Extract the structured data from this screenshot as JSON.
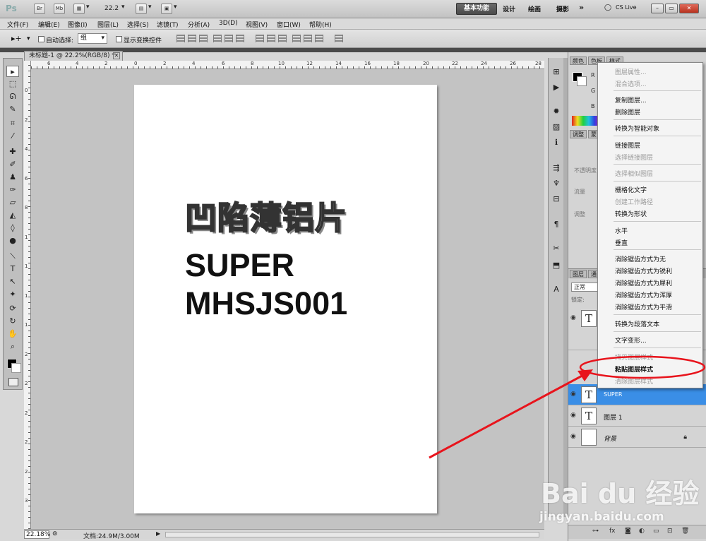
{
  "appbar": {
    "logo": "Ps",
    "btn_bridge": "Br",
    "btn_minibridge": "Mb",
    "zoom": "22.2",
    "workspaces": [
      "基本功能",
      "设计",
      "绘画",
      "摄影"
    ],
    "more": "»",
    "cs_live": "CS Live"
  },
  "menubar": [
    "文件(F)",
    "编辑(E)",
    "图像(I)",
    "图层(L)",
    "选择(S)",
    "滤镜(T)",
    "分析(A)",
    "3D(D)",
    "视图(V)",
    "窗口(W)",
    "帮助(H)"
  ],
  "options": {
    "auto_select_label": "自动选择:",
    "auto_select_value": "组",
    "show_transform_label": "显示变换控件"
  },
  "document": {
    "tab_title": "未标题-1 @ 22.2%(RGB/8) *",
    "ruler_h": [
      "6",
      "4",
      "2",
      "0",
      "2",
      "4",
      "6",
      "8",
      "10",
      "12",
      "14",
      "16",
      "18",
      "20",
      "22",
      "24",
      "26",
      "28"
    ],
    "ruler_v": [
      "0",
      "2",
      "4",
      "6",
      "8",
      "1",
      "1",
      "1",
      "1",
      "2",
      "2",
      "2",
      "2",
      "2",
      "3"
    ],
    "canvas_text": {
      "title": "凹陷薄铝片",
      "line2": "SUPER",
      "line3": "MHSJS001"
    }
  },
  "statusbar": {
    "zoom": "22.18%",
    "doc_info": "文档:24.9M/3.00M"
  },
  "right_panel": {
    "tabs_top": [
      "颜色",
      "色板",
      "样式"
    ],
    "tabs_mid": [
      "调整",
      "蒙"
    ],
    "labels": [
      "R",
      "G",
      "B"
    ],
    "faded_labels": [
      "不透明度",
      "流量",
      "调整"
    ],
    "layers_tabs": [
      "图层",
      "通"
    ],
    "blend_mode": "正常",
    "lock_label": "锁定:",
    "layers": [
      {
        "name": "",
        "type": "text"
      },
      {
        "name": "SUPER",
        "type": "text",
        "selected": true
      },
      {
        "name": "图层 1",
        "type": "text"
      },
      {
        "name": "背景",
        "type": "background",
        "locked": true
      }
    ]
  },
  "context_menu": {
    "items": [
      {
        "label": "图层属性...",
        "enabled": false
      },
      {
        "label": "混合选项...",
        "enabled": false
      },
      {
        "label": "复制图层...",
        "enabled": true
      },
      {
        "label": "删除图层",
        "enabled": true
      },
      {
        "label": "转换为智能对象",
        "enabled": true
      },
      {
        "label": "链接图层",
        "enabled": true
      },
      {
        "label": "选择链接图层",
        "enabled": false
      },
      {
        "label": "选择相似图层",
        "enabled": false
      },
      {
        "label": "栅格化文字",
        "enabled": true
      },
      {
        "label": "创建工作路径",
        "enabled": false
      },
      {
        "label": "转换为形状",
        "enabled": true
      },
      {
        "label": "水平",
        "enabled": true
      },
      {
        "label": "垂直",
        "enabled": true
      },
      {
        "label": "消除锯齿方式为无",
        "enabled": true
      },
      {
        "label": "消除锯齿方式为锐利",
        "enabled": true
      },
      {
        "label": "消除锯齿方式为犀利",
        "enabled": true
      },
      {
        "label": "消除锯齿方式为浑厚",
        "enabled": true
      },
      {
        "label": "消除锯齿方式为平滑",
        "enabled": true
      },
      {
        "label": "转换为段落文本",
        "enabled": true
      },
      {
        "label": "文字变形...",
        "enabled": true
      },
      {
        "label": "拷贝图层样式",
        "enabled": false
      },
      {
        "label": "粘贴图层样式",
        "enabled": true,
        "highlighted": true
      },
      {
        "label": "清除图层样式",
        "enabled": false
      }
    ]
  },
  "watermark": {
    "text": "Bai du 经验",
    "url": "jingyan.baidu.com"
  },
  "colors": {
    "selection_blue": "#3a8ee6",
    "annotation_red": "#e8141c",
    "workspace_active": "#4a4a4a"
  }
}
